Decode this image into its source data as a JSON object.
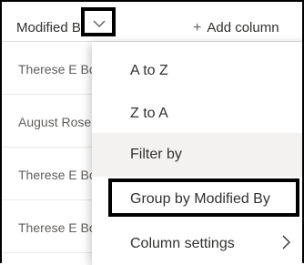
{
  "header": {
    "column_label": "Modified By",
    "add_column_label": "Add column"
  },
  "rows": [
    {
      "modified_by": "Therese E Bo"
    },
    {
      "modified_by": "August Rose"
    },
    {
      "modified_by": "Therese E Bo"
    },
    {
      "modified_by": "Therese E Bo"
    }
  ],
  "menu": {
    "items": [
      {
        "label": "A to Z"
      },
      {
        "label": "Z to A"
      },
      {
        "label": "Filter by"
      },
      {
        "label": "Group by Modified By"
      },
      {
        "label": "Column settings"
      }
    ]
  }
}
